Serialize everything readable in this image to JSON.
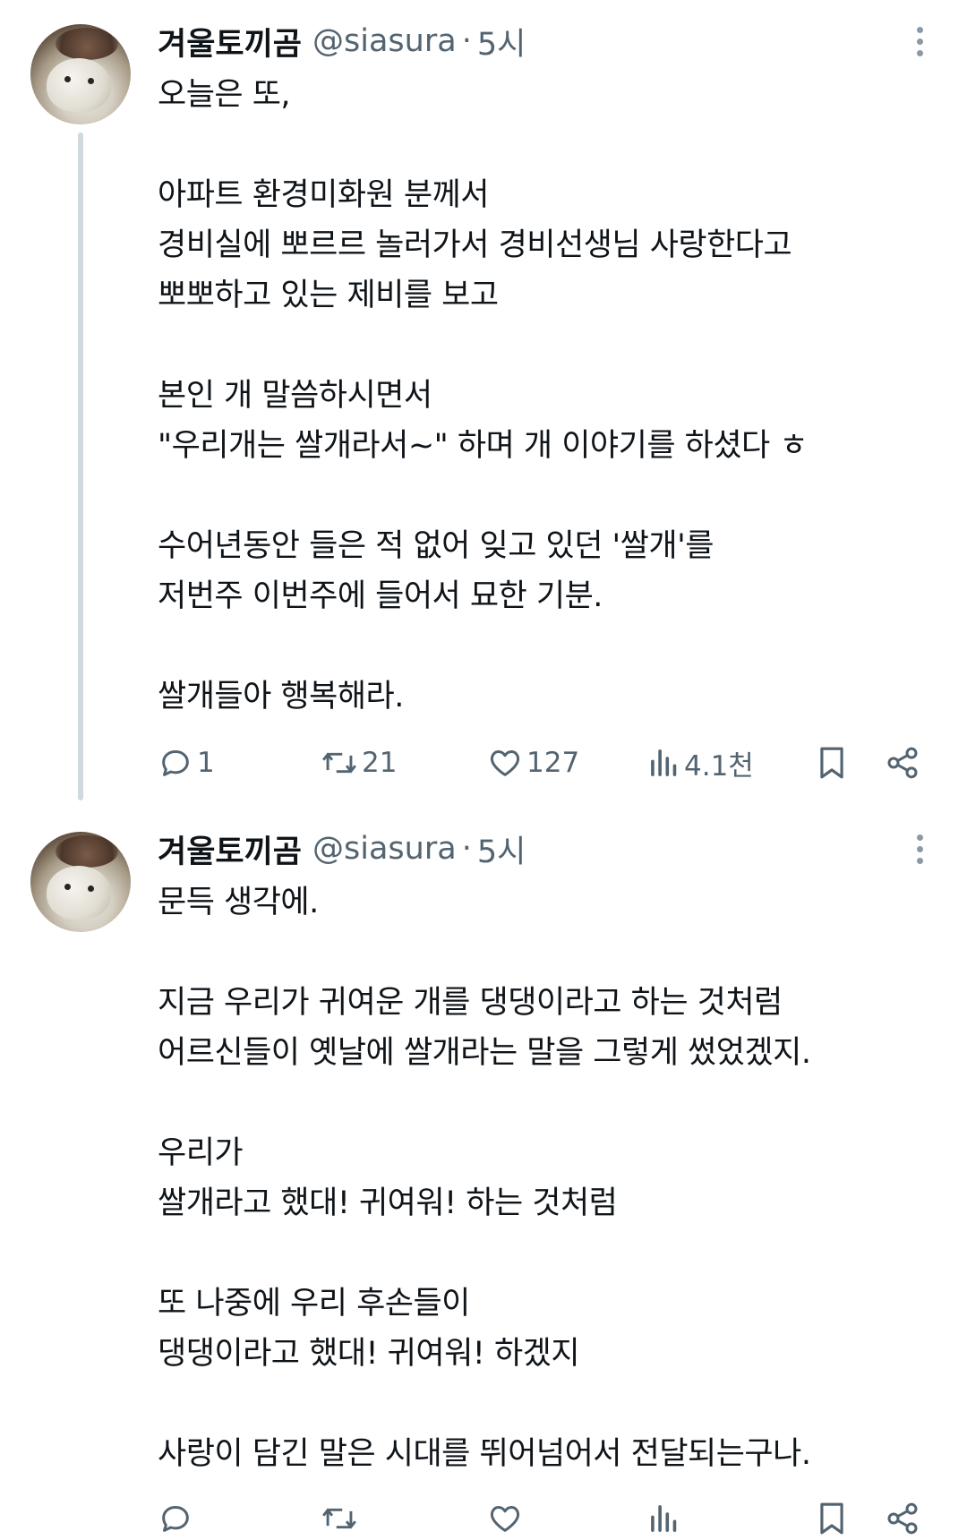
{
  "tweets": [
    {
      "author": {
        "name": "겨울토끼곰",
        "handle": "@siasura",
        "separator": "·",
        "time": "5시"
      },
      "lines": [
        "오늘은 또,",
        "",
        "아파트 환경미화원 분께서",
        "경비실에 뽀르르 놀러가서 경비선생님 사랑한다고",
        "뽀뽀하고 있는 제비를 보고",
        "",
        "본인 개 말씀하시면서",
        "\"우리개는 쌀개라서~\" 하며 개 이야기를 하셨다 ㅎ",
        "",
        "수어년동안 들은 적 없어 잊고 있던 '쌀개'를",
        "저번주 이번주에 들어서 묘한 기분.",
        "",
        "쌀개들아 행복해라."
      ],
      "actions": {
        "replies": "1",
        "retweets": "21",
        "likes": "127",
        "views": "4.1천"
      }
    },
    {
      "author": {
        "name": "겨울토끼곰",
        "handle": "@siasura",
        "separator": "·",
        "time": "5시"
      },
      "lines": [
        "문득 생각에.",
        "",
        "지금 우리가 귀여운 개를 댕댕이라고 하는 것처럼",
        "어르신들이 옛날에 쌀개라는 말을 그렇게 썼었겠지.",
        "",
        "우리가",
        "쌀개라고 했대! 귀여워! 하는 것처럼",
        "",
        "또 나중에 우리 후손들이",
        "댕댕이라고 했대! 귀여워! 하겠지",
        "",
        "사랑이 담긴 말은 시대를 뛰어넘어서 전달되는구나."
      ],
      "actions": {
        "replies": "",
        "retweets": "",
        "likes": "",
        "views": ""
      }
    }
  ],
  "icons": {
    "reply": "reply-icon",
    "retweet": "retweet-icon",
    "like": "heart-icon",
    "views": "views-chart-icon",
    "bookmark": "bookmark-icon",
    "share": "share-icon",
    "more": "more-vertical-icon"
  },
  "colors": {
    "text": "#0f1419",
    "secondary": "#536471",
    "thread_line": "#cfd9de"
  }
}
